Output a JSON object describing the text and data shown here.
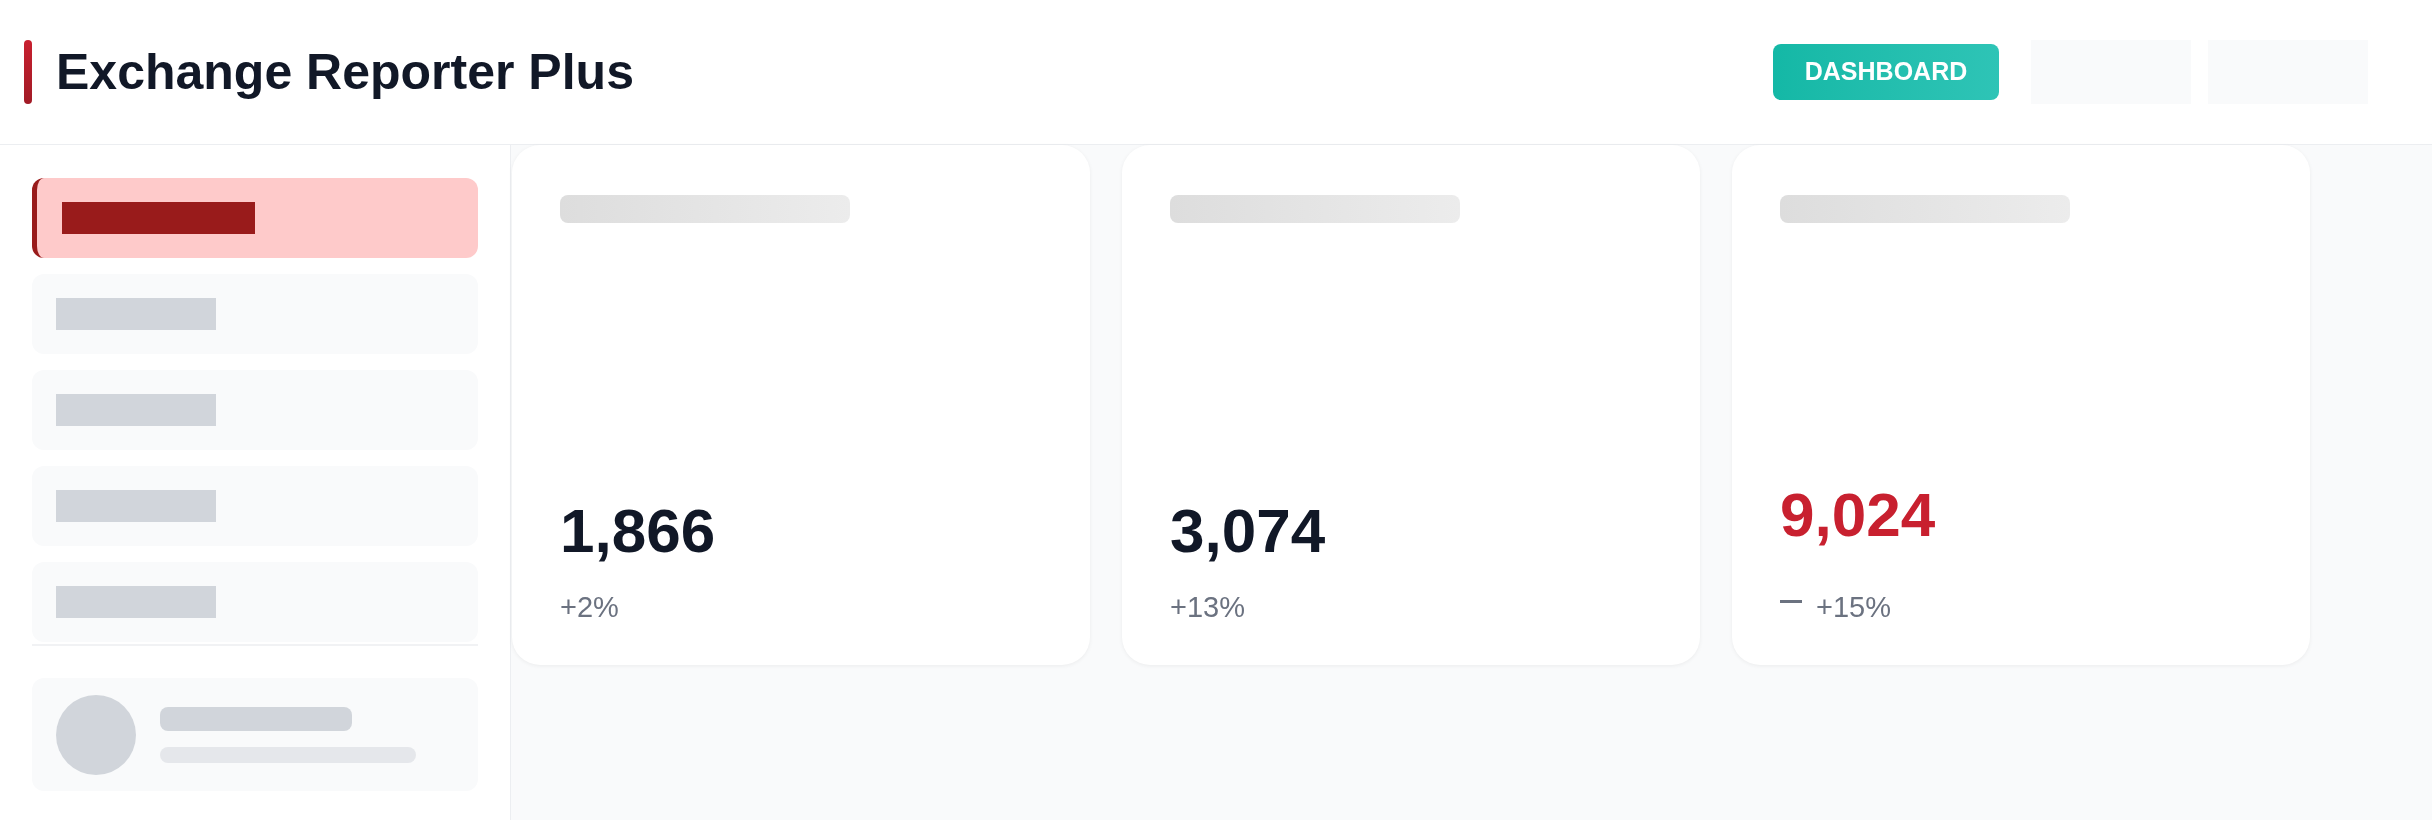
{
  "header": {
    "title": "Exchange Reporter Plus",
    "button": "DASHBOARD"
  },
  "sidebar": {
    "items": [
      {
        "selected": true
      },
      {
        "selected": false
      },
      {
        "selected": false
      },
      {
        "selected": false
      },
      {
        "selected": false
      }
    ]
  },
  "cards": [
    {
      "kind": "plain",
      "value": "1,866",
      "change": "+2%",
      "alert": false
    },
    {
      "kind": "plain",
      "value": "3,074",
      "change": "+13%",
      "alert": false
    },
    {
      "kind": "marked",
      "value": "9,024",
      "change": "+15%",
      "alert": true
    }
  ]
}
